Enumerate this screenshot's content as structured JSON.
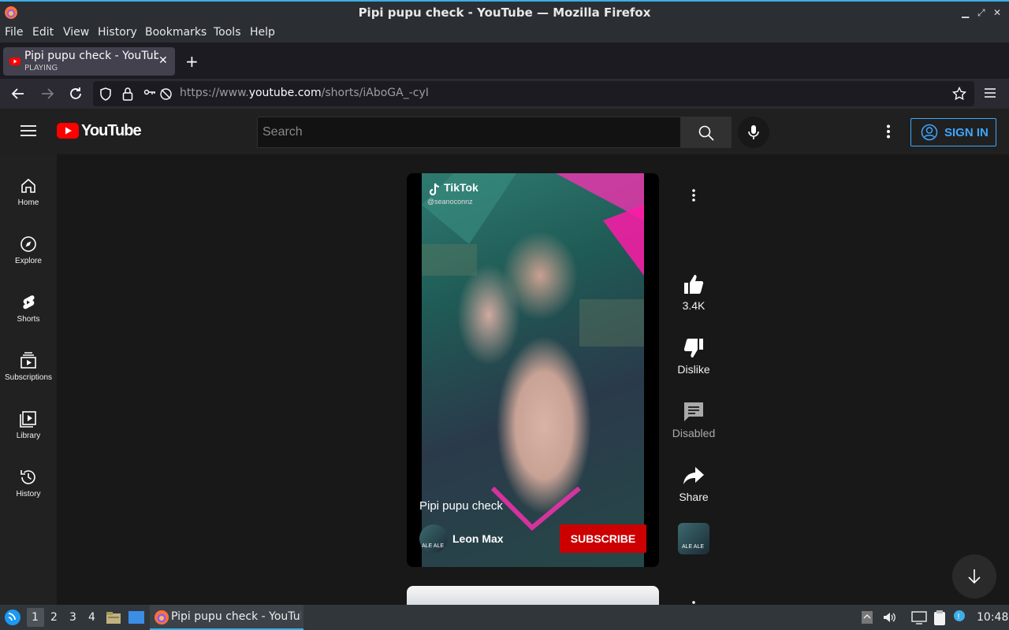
{
  "window": {
    "title": "Pipi pupu check - YouTube — Mozilla Firefox"
  },
  "menubar": {
    "items": [
      "File",
      "Edit",
      "View",
      "History",
      "Bookmarks",
      "Tools",
      "Help"
    ]
  },
  "tab": {
    "title": "Pipi pupu check - YouTube",
    "status": "PLAYING"
  },
  "navbar": {
    "url_prefix": "https://www.",
    "url_host": "youtube.com",
    "url_path": "/shorts/iAboGA_-cyI"
  },
  "youtube": {
    "logo_text": "YouTube",
    "search_placeholder": "Search",
    "sign_in": "SIGN IN",
    "accent_red": "#ff0000",
    "link_blue": "#3ea6ff"
  },
  "sidebar": {
    "items": [
      {
        "label": "Home",
        "icon": "home-icon"
      },
      {
        "label": "Explore",
        "icon": "compass-icon"
      },
      {
        "label": "Shorts",
        "icon": "shorts-icon"
      },
      {
        "label": "Subscriptions",
        "icon": "subscriptions-icon"
      },
      {
        "label": "Library",
        "icon": "library-icon"
      },
      {
        "label": "History",
        "icon": "history-icon"
      }
    ]
  },
  "short": {
    "watermark": "TikTok",
    "watermark_handle": "@seanoconnz",
    "title": "Pipi pupu check",
    "channel": "Leon Max",
    "subscribe": "SUBSCRIBE",
    "avatar_text": "ALE ALE"
  },
  "actions": {
    "like": "3.4K",
    "dislike": "Dislike",
    "comments": "Disabled",
    "share": "Share"
  },
  "taskbar": {
    "workspaces": [
      "1",
      "2",
      "3",
      "4"
    ],
    "active_app": "Pipi pupu check - YouTube — Mozilla Firefox",
    "clock": "10:48"
  }
}
